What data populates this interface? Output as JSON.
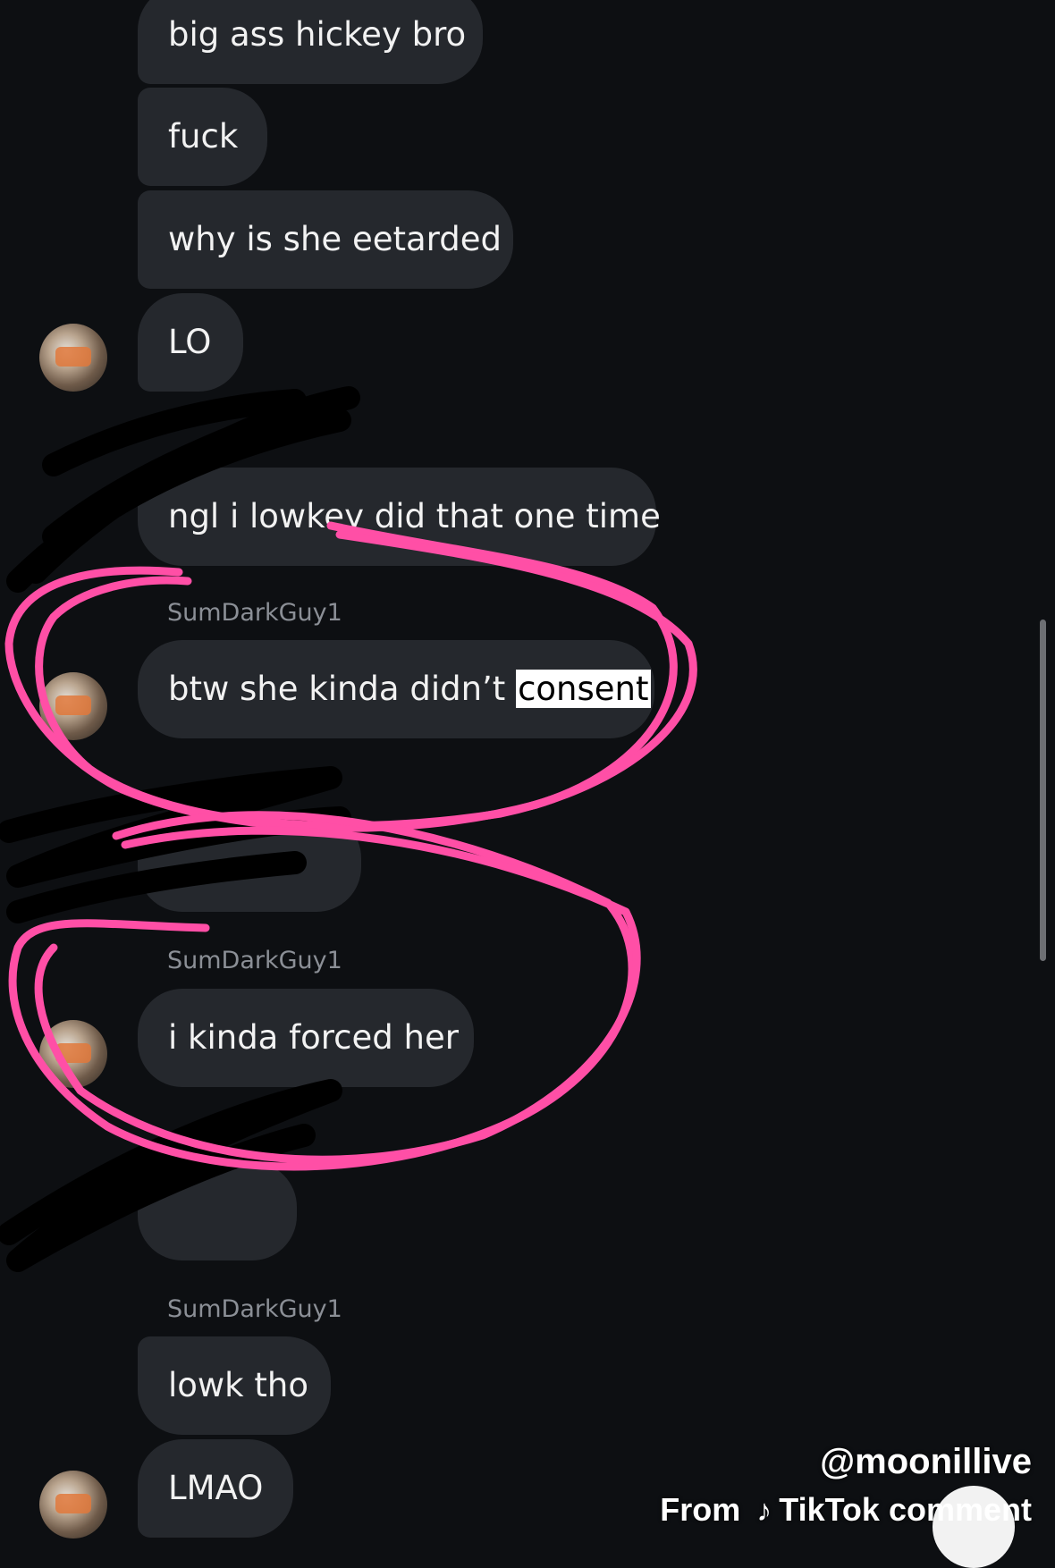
{
  "messages": [
    {
      "text": "big ass hickey bro"
    },
    {
      "text": "fuck"
    },
    {
      "text": "why is she eetarded"
    },
    {
      "text": "LO"
    },
    {
      "text": "ngl i lowkey did that one time"
    },
    {
      "sender": "SumDarkGuy1",
      "text_before": "btw she kinda didn’t ",
      "highlighted": "consent"
    },
    {
      "sender": "SumDarkGuy1",
      "text": "i kinda forced her"
    },
    {
      "sender": "SumDarkGuy1",
      "text": "lowk tho"
    },
    {
      "text": "LMAO"
    }
  ],
  "watermark": {
    "handle": "@moonillive",
    "from": "From",
    "platform": "TikTok",
    "suffix": "comment"
  },
  "colors": {
    "background": "#0d0f12",
    "bubble": "#25282d",
    "annotation": "#ff4fa6",
    "scribble": "#000000"
  }
}
